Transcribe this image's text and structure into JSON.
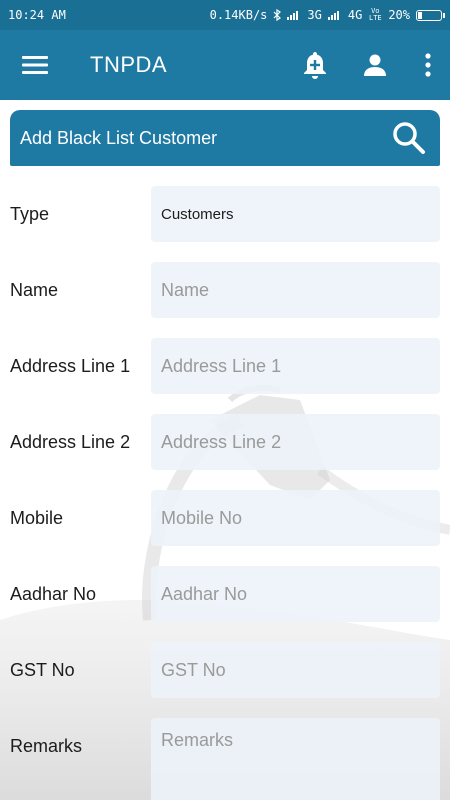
{
  "status_bar": {
    "time": "10:24 AM",
    "network_speed": "0.14KB/s",
    "signal_1": "3G",
    "signal_2": "4G",
    "volte": "Vo LTE",
    "battery": "20%",
    "battery_level": 0.2
  },
  "toolbar": {
    "title": "TNPDA",
    "icons": [
      "menu-icon",
      "add-notification-icon",
      "person-icon",
      "more-vert-icon"
    ]
  },
  "search_card": {
    "title": "Add Black List Customer",
    "icon": "search-icon"
  },
  "form": {
    "fields": [
      {
        "label": "Type",
        "value": "Customers",
        "placeholder": ""
      },
      {
        "label": "Name",
        "value": "",
        "placeholder": "Name"
      },
      {
        "label": "Address Line 1",
        "value": "",
        "placeholder": "Address Line 1"
      },
      {
        "label": "Address Line 2",
        "value": "",
        "placeholder": "Address Line 2"
      },
      {
        "label": "Mobile",
        "value": "",
        "placeholder": "Mobile No"
      },
      {
        "label": "Aadhar No",
        "value": "",
        "placeholder": "Aadhar No"
      },
      {
        "label": "GST No",
        "value": "",
        "placeholder": "GST No"
      },
      {
        "label": "Remarks",
        "value": "",
        "placeholder": "Remarks"
      }
    ]
  },
  "colors": {
    "primary": "#1e7aa3",
    "status_bar": "#1a6f95",
    "field_background": "#ecf3f8",
    "placeholder_text": "#9a9a9a"
  }
}
